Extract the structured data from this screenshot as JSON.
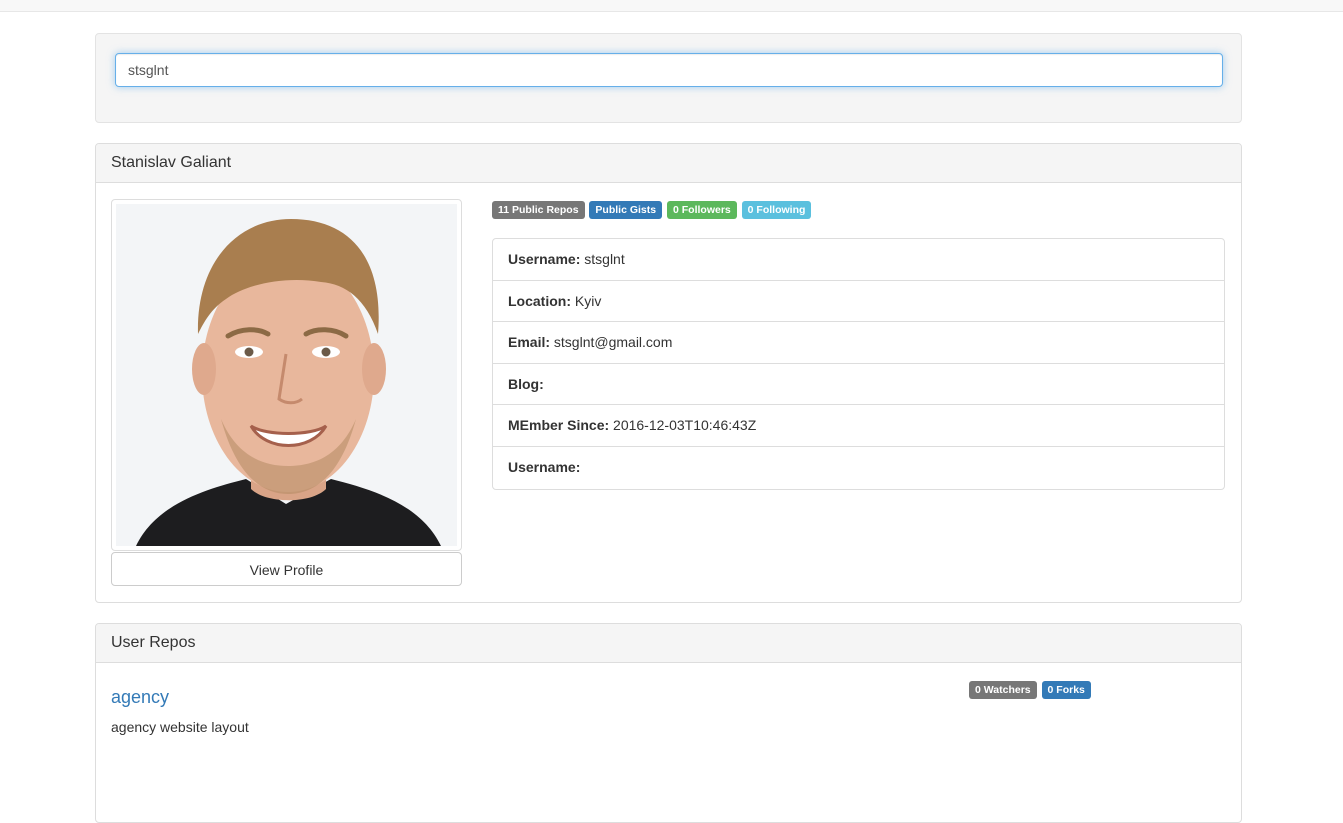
{
  "search": {
    "value": "stsglnt"
  },
  "profile": {
    "name": "Stanislav Galiant",
    "view_profile_label": "View Profile",
    "badges": {
      "repos": "11 Public Repos",
      "gists": "Public Gists",
      "followers": "0 Followers",
      "following": "0 Following"
    },
    "details": [
      {
        "label": "Username:",
        "value": "stsglnt"
      },
      {
        "label": "Location:",
        "value": "Kyiv"
      },
      {
        "label": "Email:",
        "value": "stsglnt@gmail.com"
      },
      {
        "label": "Blog:",
        "value": ""
      },
      {
        "label": "MEmber Since:",
        "value": "2016-12-03T10:46:43Z"
      },
      {
        "label": "Username:",
        "value": ""
      }
    ]
  },
  "repos": {
    "heading": "User Repos",
    "items": [
      {
        "name": "agency",
        "description": "agency website layout",
        "watchers": "0 Watchers",
        "forks": "0 Forks"
      }
    ]
  }
}
